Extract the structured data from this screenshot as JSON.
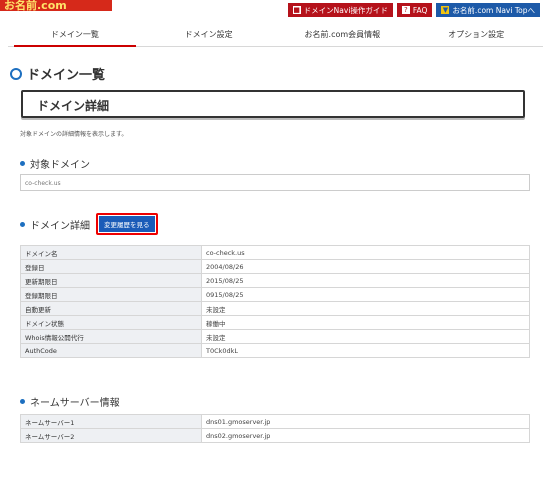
{
  "logo": {
    "text": "お名前.com"
  },
  "toplinks": [
    {
      "label": "ドメインNavi操作ガイド",
      "icon": "guide-icon",
      "color": "#b5121b"
    },
    {
      "label": "FAQ",
      "icon": "question-icon",
      "color": "#b5121b"
    },
    {
      "label": "お名前.com Navi Topへ",
      "icon": "beginner-mark-icon",
      "color": "#1d5aa8"
    }
  ],
  "nav": {
    "tabs": [
      "ドメイン一覧",
      "ドメイン設定",
      "お名前.com会員情報",
      "オプション設定"
    ],
    "active": 0
  },
  "page_title": "ドメイン一覧",
  "detail_title": "ドメイン詳細",
  "description": "対象ドメインの詳細情報を表示します。",
  "target_section": {
    "title": "対象ドメイン",
    "domain": "co-check.us"
  },
  "detail_section": {
    "title": "ドメイン詳細",
    "history_button": "変更履歴を見る",
    "rows": [
      {
        "key": "ドメイン名",
        "value": "co-check.us"
      },
      {
        "key": "登録日",
        "value": "2004/08/26"
      },
      {
        "key": "更新期限日",
        "value": "2015/08/25"
      },
      {
        "key": "登録期限日",
        "value": "0915/08/25"
      },
      {
        "key": "自動更新",
        "value": "未設定"
      },
      {
        "key": "ドメイン状態",
        "value": "稼働中"
      },
      {
        "key": "Whois情報公開代行",
        "value": "未設定"
      },
      {
        "key": "AuthCode",
        "value": "T0Ck0dkL"
      }
    ]
  },
  "ns_section": {
    "title": "ネームサーバー情報",
    "rows": [
      {
        "key": "ネームサーバー1",
        "value": "dns01.gmoserver.jp"
      },
      {
        "key": "ネームサーバー2",
        "value": "dns02.gmoserver.jp"
      }
    ]
  },
  "colors": {
    "accent_red": "#b5121b",
    "accent_blue": "#1d5aa8",
    "section_dot": "#1d6fc0"
  }
}
